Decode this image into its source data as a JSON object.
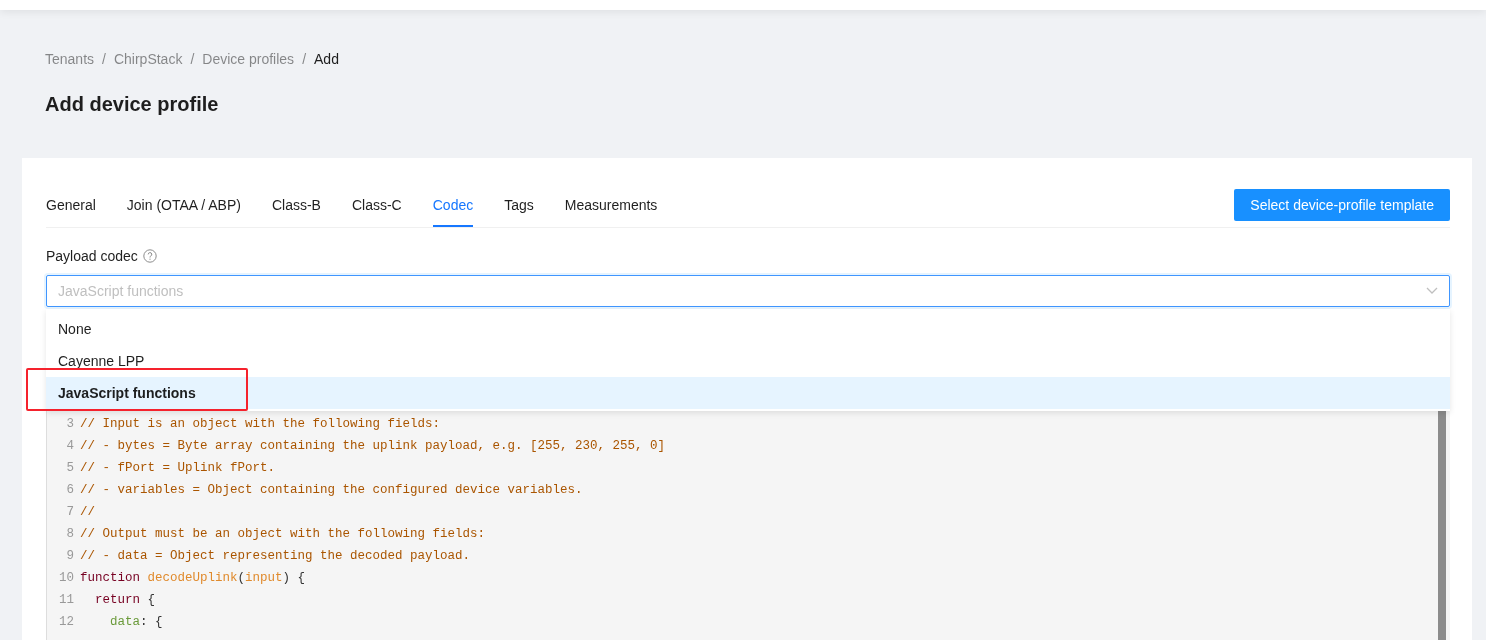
{
  "breadcrumb": [
    {
      "label": "Tenants",
      "current": false
    },
    {
      "label": "ChirpStack",
      "current": false
    },
    {
      "label": "Device profiles",
      "current": false
    },
    {
      "label": "Add",
      "current": true
    }
  ],
  "breadcrumb_separator": "/",
  "title": "Add device profile",
  "tabs": [
    {
      "label": "General",
      "selected": false
    },
    {
      "label": "Join (OTAA / ABP)",
      "selected": false
    },
    {
      "label": "Class-B",
      "selected": false
    },
    {
      "label": "Class-C",
      "selected": false
    },
    {
      "label": "Codec",
      "selected": true
    },
    {
      "label": "Tags",
      "selected": false
    },
    {
      "label": "Measurements",
      "selected": false
    }
  ],
  "template_button": "Select device-profile template",
  "payload_codec": {
    "label": "Payload codec",
    "placeholder": "JavaScript functions",
    "expanded": true,
    "options": [
      {
        "label": "None",
        "selected": false,
        "highlighted": false
      },
      {
        "label": "Cayenne LPP",
        "selected": false,
        "highlighted": false
      },
      {
        "label": "JavaScript functions",
        "selected": true,
        "highlighted": true
      }
    ]
  },
  "code_editor": {
    "lines": [
      {
        "number": "3",
        "tokens": [
          {
            "kind": "comment",
            "text": "// Input is an object with the following fields:"
          }
        ]
      },
      {
        "number": "4",
        "tokens": [
          {
            "kind": "comment",
            "text": "// - bytes = Byte array containing the uplink payload, e.g. [255, 230, 255, 0]"
          }
        ]
      },
      {
        "number": "5",
        "tokens": [
          {
            "kind": "comment",
            "text": "// - fPort = Uplink fPort."
          }
        ]
      },
      {
        "number": "6",
        "tokens": [
          {
            "kind": "comment",
            "text": "// - variables = Object containing the configured device variables."
          }
        ]
      },
      {
        "number": "7",
        "tokens": [
          {
            "kind": "comment",
            "text": "//"
          }
        ]
      },
      {
        "number": "8",
        "tokens": [
          {
            "kind": "comment",
            "text": "// Output must be an object with the following fields:"
          }
        ]
      },
      {
        "number": "9",
        "tokens": [
          {
            "kind": "comment",
            "text": "// - data = Object representing the decoded payload."
          }
        ]
      },
      {
        "number": "10",
        "tokens": [
          {
            "kind": "keyword",
            "text": "function "
          },
          {
            "kind": "def",
            "text": "decodeUplink"
          },
          {
            "kind": "plain",
            "text": "("
          },
          {
            "kind": "def",
            "text": "input"
          },
          {
            "kind": "plain",
            "text": ") {"
          }
        ]
      },
      {
        "number": "11",
        "tokens": [
          {
            "kind": "keyword",
            "text": "  return"
          },
          {
            "kind": "plain",
            "text": " {"
          }
        ]
      },
      {
        "number": "12",
        "tokens": [
          {
            "kind": "property",
            "text": "    data"
          },
          {
            "kind": "plain",
            "text": ": {"
          }
        ]
      }
    ]
  }
}
